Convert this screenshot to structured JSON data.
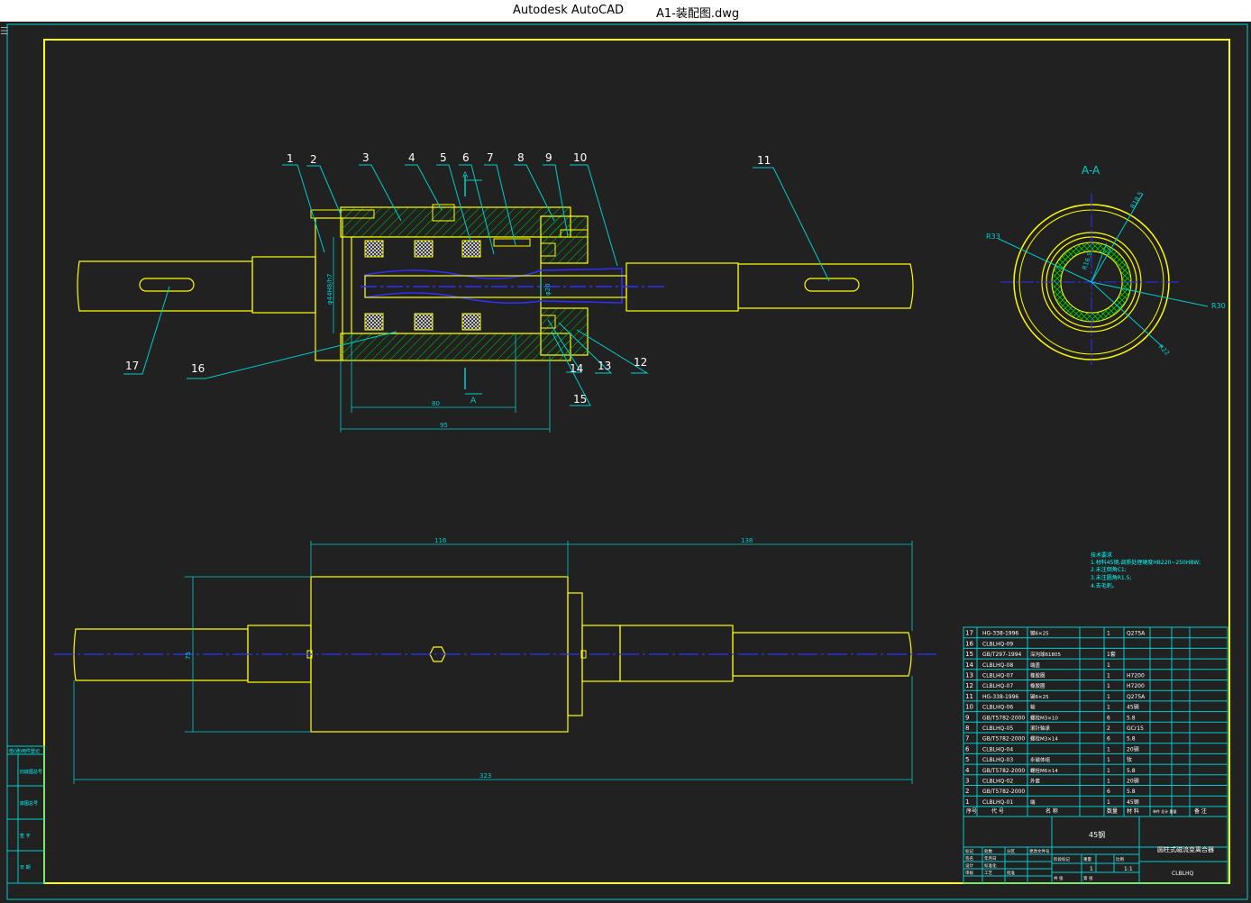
{
  "window": {
    "app_name": "Autodesk AutoCAD",
    "file_name": "A1-装配图.dwg",
    "menu_icon": "hamburger-icon"
  },
  "colors": {
    "background": "#212121",
    "border": "#ffff00",
    "table_lines": "#00ffff",
    "part_lines": "#ffff00",
    "hatch": "#00cc00",
    "centerline": "#3030ff",
    "leader": "#00ffff",
    "balloon_text": "#ffffff",
    "annotation_text": "#00ffff"
  },
  "balloons": [
    "1",
    "2",
    "3",
    "4",
    "5",
    "6",
    "7",
    "8",
    "9",
    "10",
    "11",
    "12",
    "13",
    "14",
    "15",
    "16",
    "17"
  ],
  "section_view": {
    "label": "A-A",
    "radius_labels": [
      "R33",
      "R30",
      "R22",
      "R16.5",
      "R18.5"
    ]
  },
  "cut_marks": {
    "top": "A",
    "bottom": "A"
  },
  "dimensions": {
    "main_80": "80",
    "main_95": "95",
    "dia_main": "φ44H8/h7",
    "dia_shaft": "φ20",
    "bottom_116": "116",
    "bottom_138": "138",
    "bottom_323": "323",
    "bottom_75": "75"
  },
  "tech_notes": {
    "title": "技术要求",
    "lines": [
      "1.材料45钢,调质处理硬度HB220~250HBW;",
      "2.未注倒角C1;",
      "3.未注圆角R1.5;",
      "4.去毛刺。"
    ]
  },
  "bom": {
    "rows": [
      {
        "no": "17",
        "code": "HG-338-1996",
        "name": "键6×25",
        "qty": "1",
        "mat": "Q275A"
      },
      {
        "no": "16",
        "code": "CLBLHQ-09",
        "name": "",
        "qty": "",
        "mat": ""
      },
      {
        "no": "15",
        "code": "GB/T297-1994",
        "name": "深沟球61805",
        "qty": "1套",
        "mat": ""
      },
      {
        "no": "14",
        "code": "CLBLHQ-08",
        "name": "端盖",
        "qty": "1",
        "mat": ""
      },
      {
        "no": "13",
        "code": "CLBLHQ-07",
        "name": "橡胶圈",
        "qty": "1",
        "mat": "H7200"
      },
      {
        "no": "12",
        "code": "CLBLHQ-07",
        "name": "橡胶圈",
        "qty": "1",
        "mat": "H7200"
      },
      {
        "no": "11",
        "code": "HG-338-1996",
        "name": "键6×25",
        "qty": "1",
        "mat": "Q275A"
      },
      {
        "no": "10",
        "code": "CLBLHQ-06",
        "name": "轴",
        "qty": "1",
        "mat": "45钢"
      },
      {
        "no": "9",
        "code": "GB/T5782-2000",
        "name": "螺栓M3×10",
        "qty": "6",
        "mat": "5.8"
      },
      {
        "no": "8",
        "code": "CLBLHQ-05",
        "name": "滚针轴承",
        "qty": "2",
        "mat": "GCr15"
      },
      {
        "no": "7",
        "code": "GB/T5782-2000",
        "name": "螺栓M3×14",
        "qty": "6",
        "mat": "5.8"
      },
      {
        "no": "6",
        "code": "CLBLHQ-04",
        "name": "",
        "qty": "1",
        "mat": "20钢"
      },
      {
        "no": "5",
        "code": "CLBLHQ-03",
        "name": "永磁体组",
        "qty": "1",
        "mat": "钕"
      },
      {
        "no": "4",
        "code": "GB/T5782-2000",
        "name": "螺栓M6×14",
        "qty": "1",
        "mat": "5.8"
      },
      {
        "no": "3",
        "code": "CLBLHQ-02",
        "name": "外套",
        "qty": "1",
        "mat": "20钢"
      },
      {
        "no": "2",
        "code": "GB/T5782-2000",
        "name": "",
        "qty": "6",
        "mat": "5.8"
      },
      {
        "no": "1",
        "code": "CLBLHQ-01",
        "name": "端",
        "qty": "1",
        "mat": "45钢"
      }
    ],
    "header": {
      "no": "序号",
      "code": "代 号",
      "name": "名 称",
      "qty": "数量",
      "mat": "材 料",
      "weight": "单件 总计 重量",
      "remark": "备 注"
    }
  },
  "title_block": {
    "material": "45钢",
    "drawing_name": "圆柱式磁流变离合器",
    "drawing_code": "CLBLHQ",
    "scale": "1:1",
    "sheet_count": "1",
    "cells": [
      "标记",
      "处数",
      "分区",
      "更改文件号",
      "签名",
      "年月日",
      "设计",
      "标准化",
      "阶段标记",
      "重量",
      "比例",
      "审核",
      "工艺",
      "批准",
      "共 张",
      "第 张"
    ]
  },
  "left_strip": {
    "label_top": "借(通)用件登记",
    "rows": [
      "旧底图总号",
      "底图总号",
      "签 字",
      "日 期"
    ]
  }
}
